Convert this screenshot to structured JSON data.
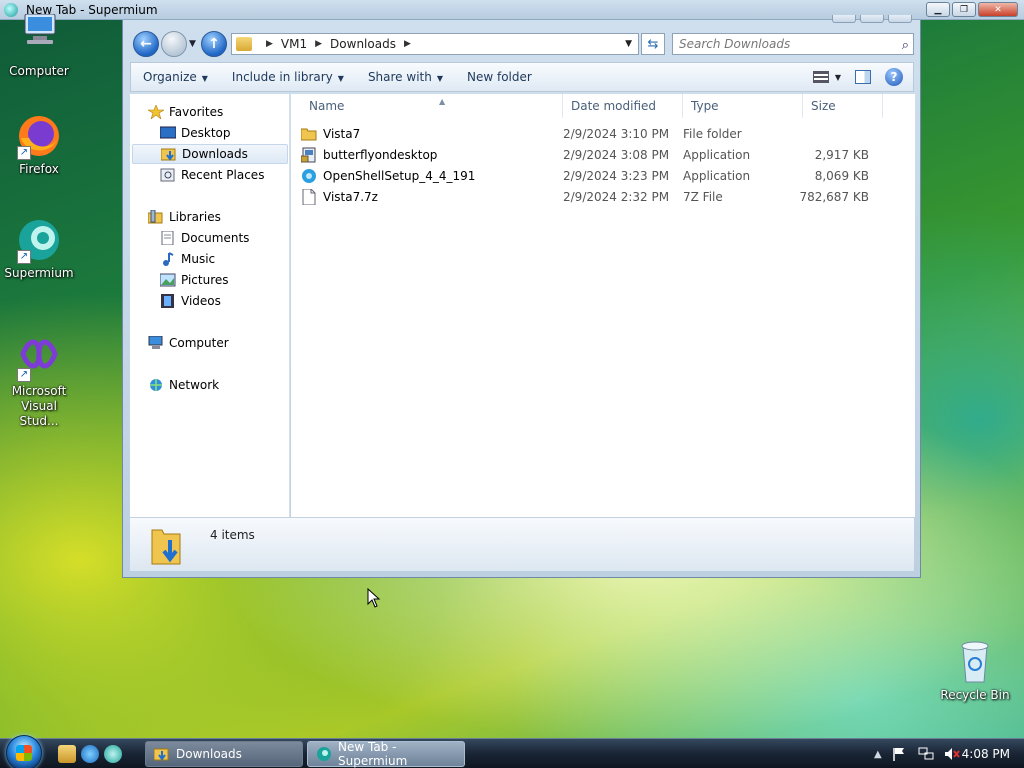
{
  "browser_window": {
    "title": "New Tab - Supermium"
  },
  "desktop": {
    "icons": [
      {
        "label": "Computer"
      },
      {
        "label": "Firefox"
      },
      {
        "label": "Supermium"
      },
      {
        "label": "Microsoft Visual Stud..."
      },
      {
        "label": "Recycle Bin"
      }
    ]
  },
  "explorer": {
    "breadcrumb": [
      "VM1",
      "Downloads"
    ],
    "search_placeholder": "Search Downloads",
    "toolbar": {
      "organize": "Organize",
      "include_in_library": "Include in library",
      "share_with": "Share with",
      "new_folder": "New folder"
    },
    "nav": {
      "favorites": "Favorites",
      "favorites_items": [
        "Desktop",
        "Downloads",
        "Recent Places"
      ],
      "libraries": "Libraries",
      "libraries_items": [
        "Documents",
        "Music",
        "Pictures",
        "Videos"
      ],
      "computer": "Computer",
      "network": "Network",
      "selected": "Downloads"
    },
    "columns": [
      "Name",
      "Date modified",
      "Type",
      "Size"
    ],
    "files": [
      {
        "name": "Vista7",
        "date": "2/9/2024 3:10 PM",
        "type": "File folder",
        "size": "",
        "icon": "folder-icon"
      },
      {
        "name": "butterflyondesktop",
        "date": "2/9/2024 3:08 PM",
        "type": "Application",
        "size": "2,917 KB",
        "icon": "installer-icon"
      },
      {
        "name": "OpenShellSetup_4_4_191",
        "date": "2/9/2024 3:23 PM",
        "type": "Application",
        "size": "8,069 KB",
        "icon": "shell-icon"
      },
      {
        "name": "Vista7.7z",
        "date": "2/9/2024 2:32 PM",
        "type": "7Z File",
        "size": "782,687 KB",
        "icon": "file-icon"
      }
    ],
    "details": {
      "count": "4 items"
    }
  },
  "taskbar": {
    "buttons": [
      {
        "label": "Downloads"
      },
      {
        "label": "New Tab - Supermium"
      }
    ],
    "clock": "4:08 PM"
  },
  "colors": {
    "accent": "#1f66c6",
    "taskbar": "#1a2535"
  }
}
